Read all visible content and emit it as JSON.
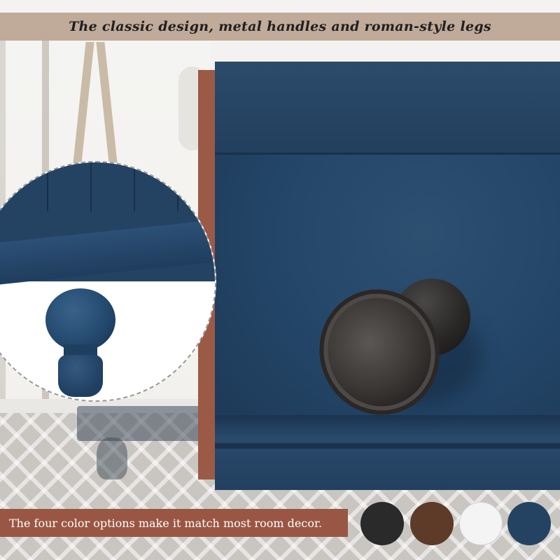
{
  "banner_top": {
    "text": "The classic design, metal handles and roman-style legs"
  },
  "banner_bottom": {
    "text": "The four color options make it match most room decor."
  },
  "color_swatches": [
    {
      "name": "black",
      "color": "#2a2a2a"
    },
    {
      "name": "brown",
      "color": "#5e3a28"
    },
    {
      "name": "white",
      "color": "#f4f4f4"
    },
    {
      "name": "navy",
      "color": "#244363"
    }
  ],
  "colors": {
    "banner_top_bg": "#c0aa99",
    "banner_bottom_bg": "#9a5644",
    "accent_bar": "#9b5a46",
    "furniture_blue": "#244363"
  }
}
